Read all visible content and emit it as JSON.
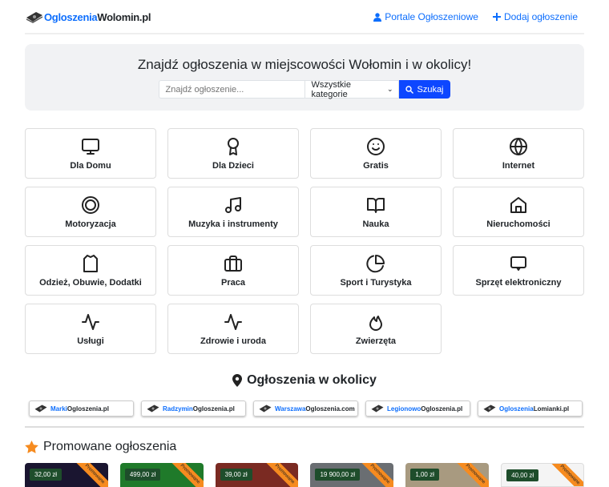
{
  "header": {
    "logo_blue": "Ogloszenia",
    "logo_dark": "Wolomin.pl",
    "nav": [
      {
        "label": "Portale Ogłoszeniowe",
        "icon": "user-icon"
      },
      {
        "label": "Dodaj ogłoszenie",
        "icon": "plus-icon"
      }
    ]
  },
  "hero": {
    "title": "Znajdź ogłoszenia w miejscowości Wołomin i w okolicy!",
    "search_placeholder": "Znajdź ogłoszenie...",
    "category_selected": "Wszystkie kategorie",
    "search_button": "Szukaj"
  },
  "categories": [
    {
      "label": "Dla Domu",
      "icon": "monitor-icon"
    },
    {
      "label": "Dla Dzieci",
      "icon": "award-icon"
    },
    {
      "label": "Gratis",
      "icon": "smile-icon"
    },
    {
      "label": "Internet",
      "icon": "globe-icon"
    },
    {
      "label": "Motoryzacja",
      "icon": "wheel-icon"
    },
    {
      "label": "Muzyka i instrumenty",
      "icon": "music-icon"
    },
    {
      "label": "Nauka",
      "icon": "book-icon"
    },
    {
      "label": "Nieruchomości",
      "icon": "home-icon"
    },
    {
      "label": "Odzież, Obuwie, Dodatki",
      "icon": "shirt-icon"
    },
    {
      "label": "Praca",
      "icon": "briefcase-icon"
    },
    {
      "label": "Sport i Turystyka",
      "icon": "pie-icon"
    },
    {
      "label": "Sprzęt elektroniczny",
      "icon": "message-icon"
    },
    {
      "label": "Usługi",
      "icon": "activity-icon"
    },
    {
      "label": "Zdrowie i uroda",
      "icon": "pulse-icon"
    },
    {
      "label": "Zwierzęta",
      "icon": "flame-icon"
    }
  ],
  "nearby": {
    "title": "Ogłoszenia w okolicy",
    "portals": [
      {
        "blue": "Marki",
        "dark": "Ogloszenia.pl"
      },
      {
        "blue": "Radzymin",
        "dark": "Ogloszenia.pl"
      },
      {
        "blue": "Warszawa",
        "dark": "Ogloszenia.com"
      },
      {
        "blue": "Legionowo",
        "dark": "Ogloszenia.pl"
      },
      {
        "blue": "Ogloszenia",
        "dark": "Lomianki.pl"
      }
    ]
  },
  "promoted": {
    "title": "Promowane ogłoszenia",
    "ribbon": "Promowane",
    "items": [
      {
        "price": "32,00 zł",
        "bg": "#1a1530"
      },
      {
        "price": "499,00 zł",
        "bg": "#1f7a2a"
      },
      {
        "price": "39,00 zł",
        "bg": "#7a2a22"
      },
      {
        "price": "19 900,00 zł",
        "bg": "#6a6e72"
      },
      {
        "price": "1,00 zł",
        "bg": "#a89a80"
      },
      {
        "price": "40,00 zł",
        "bg": "#f4f4f4"
      }
    ]
  }
}
